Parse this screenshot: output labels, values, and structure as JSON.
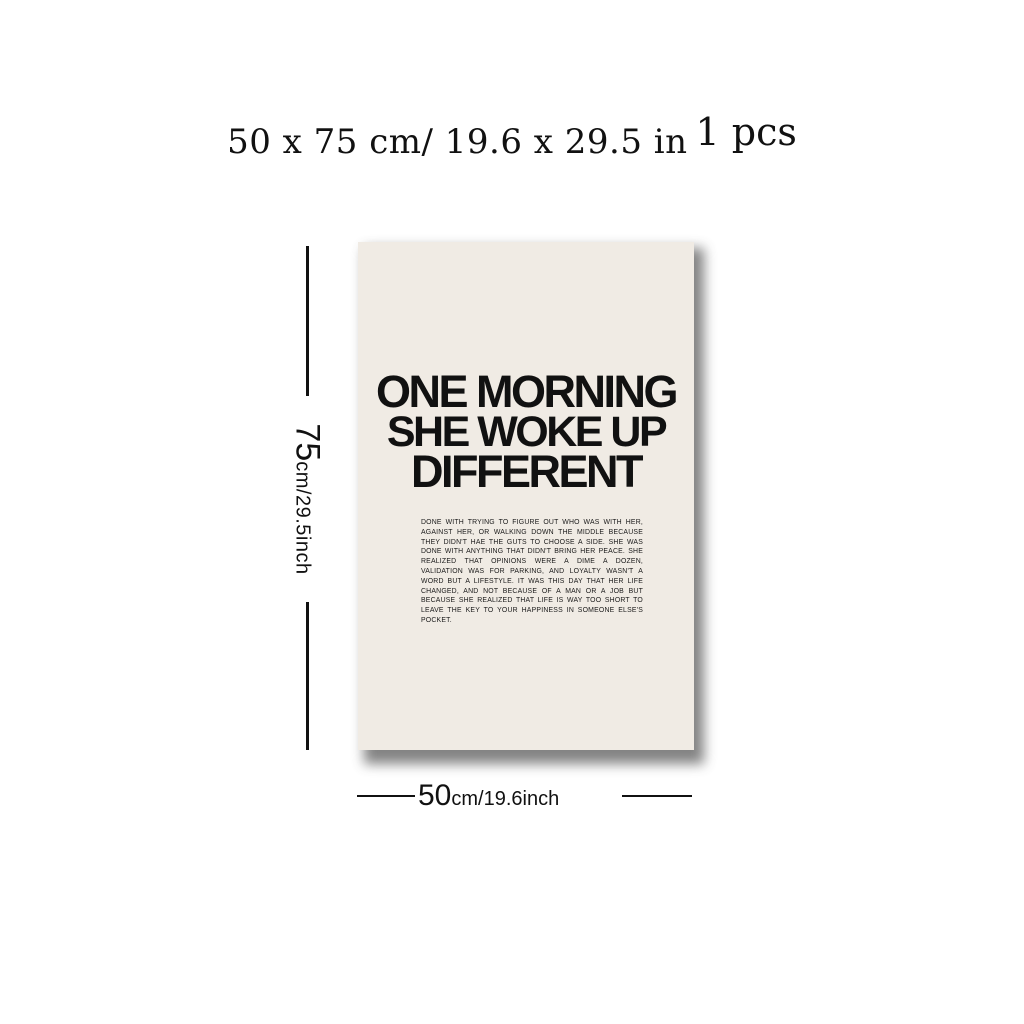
{
  "caption": {
    "dimensions": "50 x 75 cm/ 19.6  x  29.5 in",
    "quantity": "1 pcs"
  },
  "poster": {
    "title_lines": [
      "ONE MORNING",
      "SHE WOKE UP",
      "DIFFERENT"
    ],
    "body": "DONE WITH TRYING TO FIGURE OUT WHO WAS WITH HER, AGAINST HER, OR WALKING DOWN THE MIDDLE BECAUSE THEY DIDN'T HAE THE GUTS TO CHOOSE A SIDE. SHE WAS DONE WITH ANYTHING THAT DIDN'T BRING HER PEACE. SHE REALIZED THAT OPINIONS WERE A DIME A DOZEN, VALIDATION WAS FOR PARKING, AND LOYALTY WASN'T A WORD BUT A LIFESTYLE. IT WAS THIS DAY THAT HER LIFE CHANGED, AND NOT BECAUSE OF A MAN OR A JOB BUT BECAUSE SHE REALIZED THAT LIFE IS WAY TOO SHORT TO LEAVE THE KEY TO YOUR HAPPINESS IN SOMEONE ELSE'S POCKET.",
    "background_color": "#f0ebe4"
  },
  "height_label": {
    "number": "75",
    "unit": "cm/29.5inch"
  },
  "width_label": {
    "number": "50",
    "unit": "cm/19.6inch"
  }
}
